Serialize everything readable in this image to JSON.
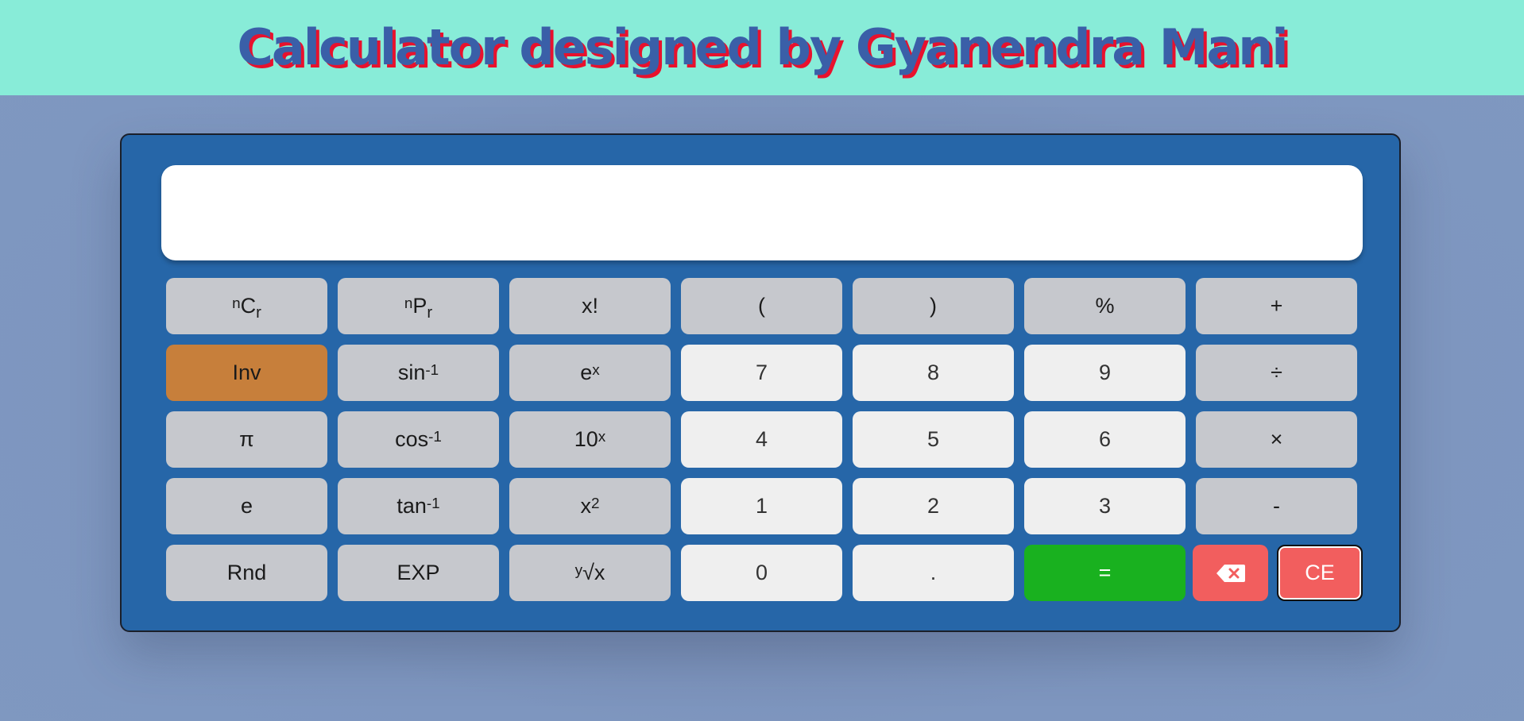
{
  "header": {
    "title": "Calculator designed by Gyanendra Mani"
  },
  "display": {
    "value": ""
  },
  "buttons": {
    "ncr": {
      "sup": "n",
      "main": "C",
      "sub": "r"
    },
    "npr": {
      "sup": "n",
      "main": "P",
      "sub": "r"
    },
    "factorial": "x!",
    "open_paren": "(",
    "close_paren": ")",
    "percent": "%",
    "plus": "+",
    "inv": "Inv",
    "asin": {
      "main": "sin",
      "sup": "-1"
    },
    "exp_e": {
      "main": "e",
      "sup": "x"
    },
    "seven": "7",
    "eight": "8",
    "nine": "9",
    "divide": "÷",
    "pi": "π",
    "acos": {
      "main": "cos",
      "sup": "-1"
    },
    "ten_pow": {
      "main": "10",
      "sup": "x"
    },
    "four": "4",
    "five": "5",
    "six": "6",
    "multiply": "×",
    "e": "e",
    "atan": {
      "main": "tan",
      "sup": "-1"
    },
    "square": {
      "main": "x",
      "sup": "2"
    },
    "one": "1",
    "two": "2",
    "three": "3",
    "minus": "-",
    "rnd": "Rnd",
    "exp": "EXP",
    "yroot": {
      "sup": "y",
      "main": "√x"
    },
    "zero": "0",
    "dot": ".",
    "equals": "=",
    "backspace_icon": "backspace-icon",
    "ce": "CE"
  },
  "colors": {
    "header_bg": "#88ecd8",
    "title_fill": "#3a5fa8",
    "title_shadow": "#e8112d",
    "calc_bg": "#2666a8",
    "fn_key": "#c6c8cd",
    "num_key": "#efefef",
    "inv_key": "#c77f3b",
    "equals_key": "#19b11f",
    "clear_keys": "#f25e5e"
  }
}
